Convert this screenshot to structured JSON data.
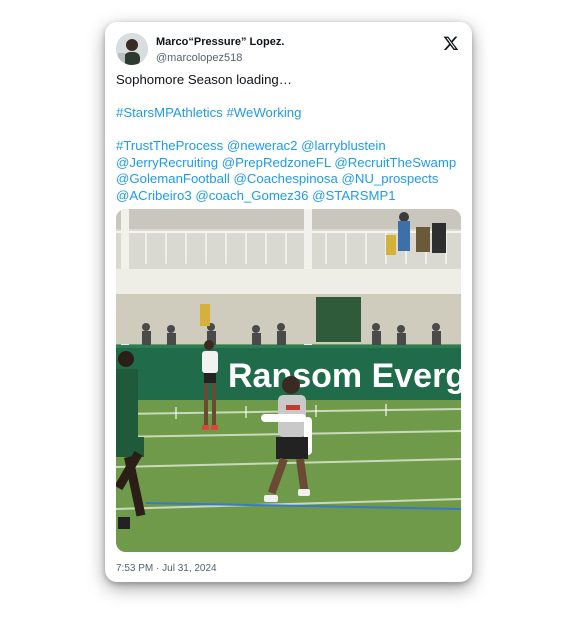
{
  "tweet": {
    "display_name": "Marco“Pressure” Lopez.",
    "handle": "@marcolopez518",
    "platform_icon": "x-logo-icon",
    "line1": "Sophomore Season loading…",
    "hashtags": [
      "#StarsMPAthletics",
      "#WeWorking"
    ],
    "mentions_line_lead": "#TrustTheProcess",
    "mentions": [
      "@newerac2",
      "@larryblustein",
      "@JerryRecruiting",
      "@PrepRedzoneFL",
      "@RecruitTheSwamp",
      "@GolemanFootball",
      "@Coachespinosa",
      "@NU_prospects",
      "@ACribeiro3",
      "@coach_Gomez36",
      "@STARSMP1"
    ],
    "timestamp": "7:53 PM · Jul 31, 2024"
  },
  "photo": {
    "banner_text": "Ransom Evergl",
    "colors": {
      "field": "#6f9a4a",
      "banner": "#1f6b4a",
      "building": "#e8e6df",
      "link": "#1d9bf0"
    }
  }
}
